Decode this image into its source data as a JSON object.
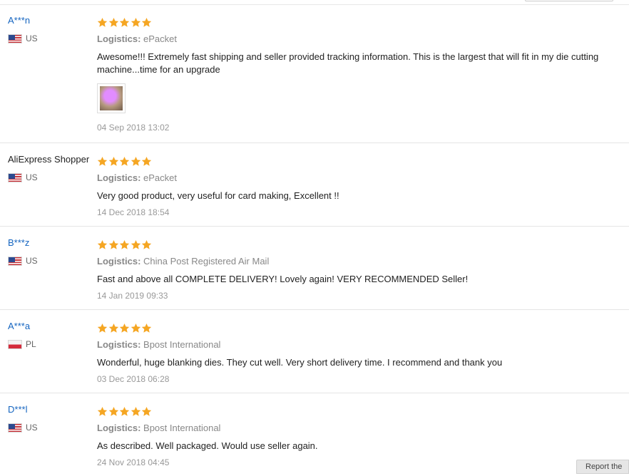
{
  "reviews": [
    {
      "user": "A***n",
      "country": "US",
      "flag": "us-flag",
      "rating": 5,
      "logistics_label": "Logistics:",
      "logistics": "ePacket",
      "feedback": "Awesome!!! Extremely fast shipping and seller provided tracking information. This is the largest that will fit in my die cutting machine...time for an upgrade",
      "has_photo": true,
      "date": "04 Sep 2018 13:02"
    },
    {
      "user": "AliExpress Shopper",
      "country": "US",
      "flag": "us-flag",
      "rating": 5,
      "logistics_label": "Logistics:",
      "logistics": "ePacket",
      "feedback": "Very good product, very useful for card making, Excellent !!",
      "has_photo": false,
      "date": "14 Dec 2018 18:54"
    },
    {
      "user": "B***z",
      "country": "US",
      "flag": "us-flag",
      "rating": 5,
      "logistics_label": "Logistics:",
      "logistics": "China Post Registered Air Mail",
      "feedback": "Fast and above all COMPLETE DELIVERY! Lovely again! VERY RECOMMENDED Seller!",
      "has_photo": false,
      "date": "14 Jan 2019 09:33"
    },
    {
      "user": "A***a",
      "country": "PL",
      "flag": "pl-flag",
      "rating": 5,
      "logistics_label": "Logistics:",
      "logistics": "Bpost International",
      "feedback": "Wonderful, huge blanking dies. They cut well. Very short delivery time. I recommend and thank you",
      "has_photo": false,
      "date": "03 Dec 2018 06:28"
    },
    {
      "user": "D***l",
      "country": "US",
      "flag": "us-flag",
      "rating": 5,
      "logistics_label": "Logistics:",
      "logistics": "Bpost International",
      "feedback": "As described. Well packaged. Would use seller again.",
      "has_photo": false,
      "date": "24 Nov 2018 04:45"
    }
  ],
  "colors": {
    "star": "#f5a623",
    "username_link": "#1565c0",
    "muted_text": "#999999"
  },
  "corner_button_label": "Report the"
}
